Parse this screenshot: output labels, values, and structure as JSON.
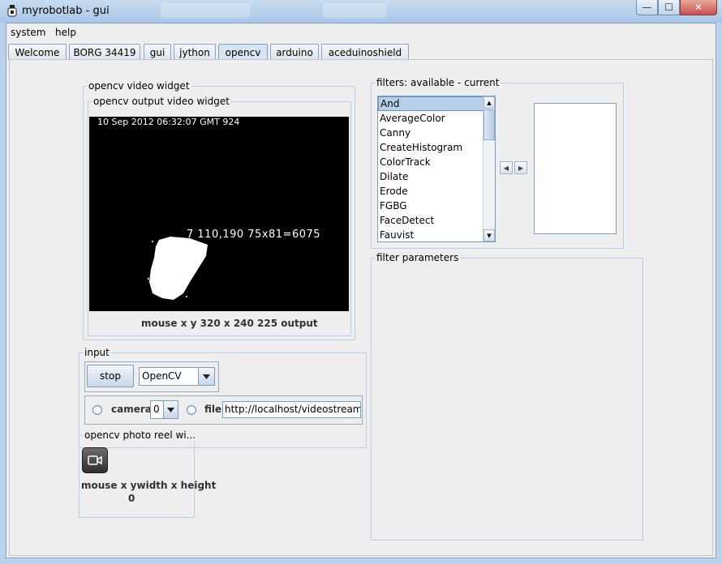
{
  "window": {
    "title": "myrobotlab - gui",
    "buttons": {
      "minimize": "—",
      "maximize": "☐",
      "close": "✕"
    }
  },
  "menu": [
    "system",
    "help"
  ],
  "tabs": [
    "Welcome",
    "BORG 34419",
    "gui",
    "jython",
    "opencv",
    "arduino",
    "aceduinoshield"
  ],
  "active_tab": "opencv",
  "video_widget": {
    "group_label": "opencv  video widget",
    "output_label": "opencv output video widget",
    "timestamp": "10 Sep 2012 06:32:07 GMT 924",
    "overlay_text": "7 110,190  75x81=6075",
    "status": "mouse x y  320 x 240  225  output"
  },
  "input": {
    "group_label": "input",
    "stop_label": "stop",
    "grabber_value": "OpenCV",
    "camera_label": "camera",
    "camera_index": "0",
    "file_label": "file",
    "file_url": "http://localhost/videostream.cgi"
  },
  "photo_reel": {
    "group_label": "opencv  photo reel wi...",
    "status": "mouse x ywidth x height",
    "count": "0"
  },
  "filters": {
    "group_label": "filters: available - current",
    "available": [
      "And",
      "AverageColor",
      "Canny",
      "CreateHistogram",
      "ColorTrack",
      "Dilate",
      "Erode",
      "FGBG",
      "FaceDetect",
      "Fauvist"
    ],
    "selected": "And"
  },
  "filter_parameters": {
    "group_label": "filter parameters"
  }
}
